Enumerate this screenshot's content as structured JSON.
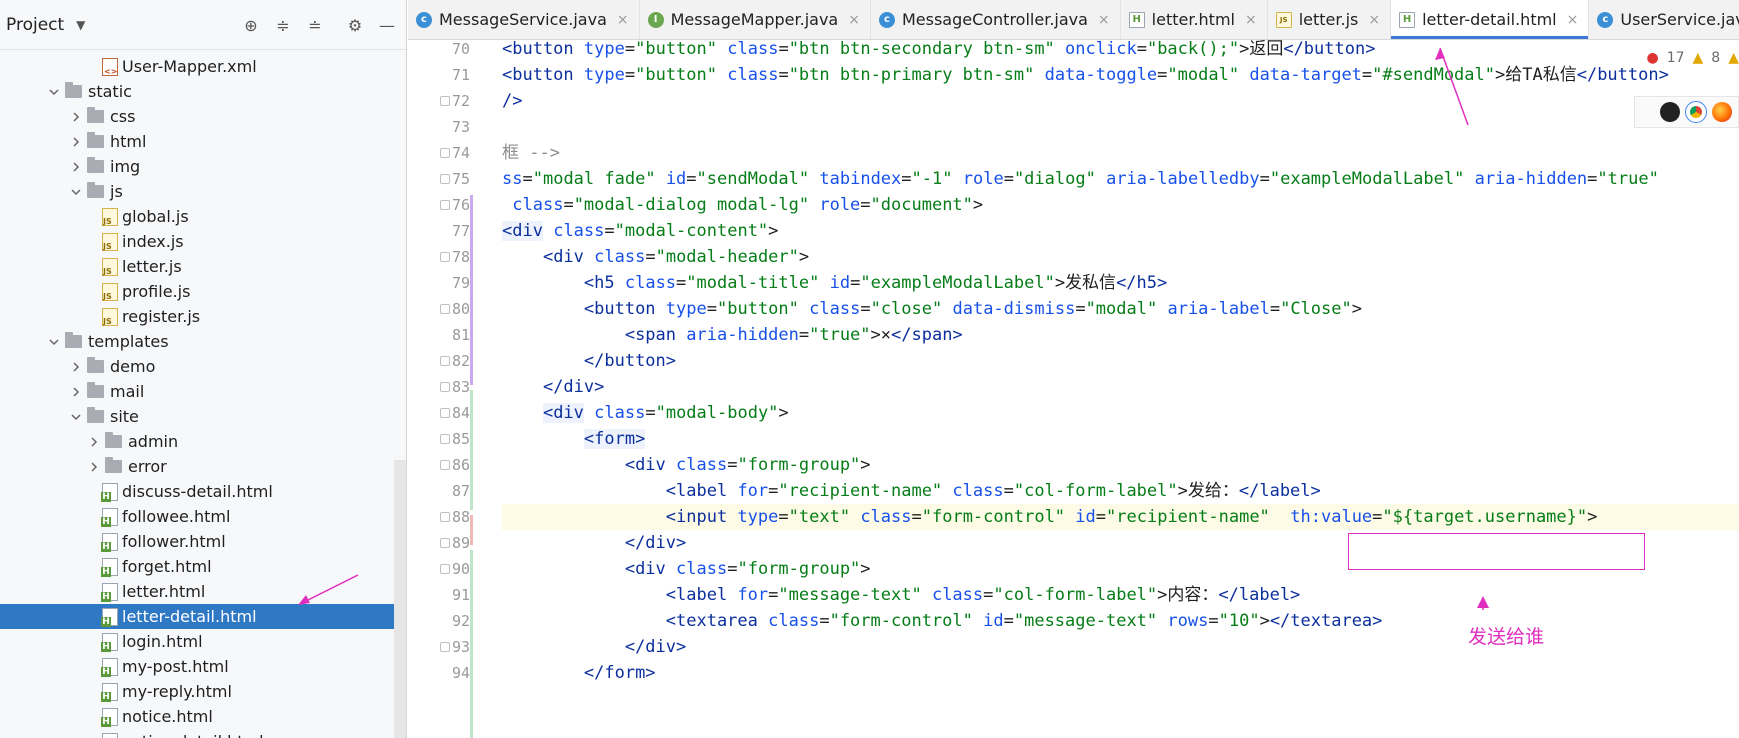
{
  "project": {
    "title": "Project",
    "tree": [
      {
        "label": "User-Mapper.xml",
        "type": "xml",
        "indent": 3,
        "arrow": ""
      },
      {
        "label": "static",
        "type": "folder",
        "indent": 1,
        "arrow": "down"
      },
      {
        "label": "css",
        "type": "folder",
        "indent": 2,
        "arrow": "right"
      },
      {
        "label": "html",
        "type": "folder",
        "indent": 2,
        "arrow": "right"
      },
      {
        "label": "img",
        "type": "folder",
        "indent": 2,
        "arrow": "right"
      },
      {
        "label": "js",
        "type": "folder",
        "indent": 2,
        "arrow": "down"
      },
      {
        "label": "global.js",
        "type": "js",
        "indent": 3,
        "arrow": ""
      },
      {
        "label": "index.js",
        "type": "js",
        "indent": 3,
        "arrow": ""
      },
      {
        "label": "letter.js",
        "type": "js",
        "indent": 3,
        "arrow": ""
      },
      {
        "label": "profile.js",
        "type": "js",
        "indent": 3,
        "arrow": ""
      },
      {
        "label": "register.js",
        "type": "js",
        "indent": 3,
        "arrow": ""
      },
      {
        "label": "templates",
        "type": "folder",
        "indent": 1,
        "arrow": "down"
      },
      {
        "label": "demo",
        "type": "folder",
        "indent": 2,
        "arrow": "right"
      },
      {
        "label": "mail",
        "type": "folder",
        "indent": 2,
        "arrow": "right"
      },
      {
        "label": "site",
        "type": "folder",
        "indent": 2,
        "arrow": "down"
      },
      {
        "label": "admin",
        "type": "folder",
        "indent": 3,
        "arrow": "right"
      },
      {
        "label": "error",
        "type": "folder",
        "indent": 3,
        "arrow": "right"
      },
      {
        "label": "discuss-detail.html",
        "type": "html",
        "indent": 3,
        "arrow": ""
      },
      {
        "label": "followee.html",
        "type": "html",
        "indent": 3,
        "arrow": ""
      },
      {
        "label": "follower.html",
        "type": "html",
        "indent": 3,
        "arrow": ""
      },
      {
        "label": "forget.html",
        "type": "html",
        "indent": 3,
        "arrow": ""
      },
      {
        "label": "letter.html",
        "type": "html",
        "indent": 3,
        "arrow": ""
      },
      {
        "label": "letter-detail.html",
        "type": "html",
        "indent": 3,
        "arrow": "",
        "selected": true
      },
      {
        "label": "login.html",
        "type": "html",
        "indent": 3,
        "arrow": ""
      },
      {
        "label": "my-post.html",
        "type": "html",
        "indent": 3,
        "arrow": ""
      },
      {
        "label": "my-reply.html",
        "type": "html",
        "indent": 3,
        "arrow": ""
      },
      {
        "label": "notice.html",
        "type": "html",
        "indent": 3,
        "arrow": ""
      },
      {
        "label": "notice-detail.html",
        "type": "html",
        "indent": 3,
        "arrow": ""
      }
    ]
  },
  "tabs": [
    {
      "label": "MessageService.java",
      "icon": "java-c"
    },
    {
      "label": "MessageMapper.java",
      "icon": "java-i"
    },
    {
      "label": "MessageController.java",
      "icon": "java-c"
    },
    {
      "label": "letter.html",
      "icon": "html"
    },
    {
      "label": "letter.js",
      "icon": "js"
    },
    {
      "label": "letter-detail.html",
      "icon": "html",
      "active": true
    },
    {
      "label": "UserService.java",
      "icon": "java-c"
    },
    {
      "label": "U",
      "icon": "java-c"
    }
  ],
  "inspections": {
    "errors": "17",
    "warnings": "8"
  },
  "code_lines": [
    {
      "n": "70",
      "html": "<span class='tag'>&lt;button</span> <span class='attr'>type</span>=<span class='str'>\"button\"</span> <span class='attr'>class</span>=<span class='str'>\"btn btn-secondary btn-sm\"</span> <span class='attr'>onclick</span>=<span class='str'>\"back();\"</span>&gt;返回<span class='tag'>&lt;/button&gt;</span>"
    },
    {
      "n": "71",
      "html": "<span class='tag'>&lt;button</span> <span class='attr'>type</span>=<span class='str'>\"button\"</span> <span class='attr'>class</span>=<span class='str'>\"btn btn-primary btn-sm\"</span> <span class='attr'>data-toggle</span>=<span class='str'>\"modal\"</span> <span class='attr'>data-target</span>=<span class='str'>\"#sendModal\"</span>&gt;给TA私信<span class='tag'>&lt;/button&gt;</span>"
    },
    {
      "n": "72",
      "html": "<span class='tag'>/&gt;</span>"
    },
    {
      "n": "73",
      "html": ""
    },
    {
      "n": "74",
      "html": "<span class='cmt'>框 --&gt;</span>"
    },
    {
      "n": "75",
      "html": "<span class='attr'>ss</span>=<span class='str'>\"modal fade\"</span> <span class='attr'>id</span>=<span class='str'>\"sendModal\"</span> <span class='attr'>tabindex</span>=<span class='str'>\"-1\"</span> <span class='attr'>role</span>=<span class='str'>\"dialog\"</span> <span class='attr'>aria-labelledby</span>=<span class='str'>\"exampleModalLabel\"</span> <span class='attr'>aria-hidden</span>=<span class='str'>\"true\"</span>"
    },
    {
      "n": "76",
      "html": " <span class='attr'>class</span>=<span class='str'>\"modal-dialog modal-lg\"</span> <span class='attr'>role</span>=<span class='str'>\"document\"</span>&gt;"
    },
    {
      "n": "77",
      "html": "<span class='tag tagbg'>&lt;div</span> <span class='attr'>class</span>=<span class='str'>\"modal-content\"</span>&gt;"
    },
    {
      "n": "78",
      "html": "    <span class='tag'>&lt;div</span> <span class='attr'>class</span>=<span class='str'>\"modal-header\"</span>&gt;"
    },
    {
      "n": "79",
      "html": "        <span class='tag'>&lt;h5</span> <span class='attr'>class</span>=<span class='str'>\"modal-title\"</span> <span class='attr'>id</span>=<span class='str'>\"exampleModalLabel\"</span>&gt;发私信<span class='tag'>&lt;/h5&gt;</span>"
    },
    {
      "n": "80",
      "html": "        <span class='tag'>&lt;button</span> <span class='attr'>type</span>=<span class='str'>\"button\"</span> <span class='attr'>class</span>=<span class='str'>\"close\"</span> <span class='attr'>data-dismiss</span>=<span class='str'>\"modal\"</span> <span class='attr'>aria-label</span>=<span class='str'>\"Close\"</span>&gt;"
    },
    {
      "n": "81",
      "html": "            <span class='tag'>&lt;span</span> <span class='attr'>aria-hidden</span>=<span class='str'>\"true\"</span>&gt;×<span class='tag'>&lt;/span&gt;</span>"
    },
    {
      "n": "82",
      "html": "        <span class='tag'>&lt;/button&gt;</span>"
    },
    {
      "n": "83",
      "html": "    <span class='tag'>&lt;/div&gt;</span>"
    },
    {
      "n": "84",
      "html": "    <span class='tag tagbg'>&lt;div</span> <span class='attr'>class</span>=<span class='str'>\"modal-body\"</span>&gt;"
    },
    {
      "n": "85",
      "html": "        <span class='tag tagbg'>&lt;form&gt;</span>"
    },
    {
      "n": "86",
      "html": "            <span class='tag'>&lt;div</span> <span class='attr'>class</span>=<span class='str'>\"form-group\"</span>&gt;"
    },
    {
      "n": "87",
      "html": "                <span class='tag'>&lt;label</span> <span class='attr'>for</span>=<span class='str'>\"recipient-name\"</span> <span class='attr'>class</span>=<span class='str'>\"col-form-label\"</span>&gt;发给：<span class='tag'>&lt;/label&gt;</span>"
    },
    {
      "n": "88",
      "html": "                <span class='tag'>&lt;input</span> <span class='attr'>type</span>=<span class='str'>\"text\"</span> <span class='attr'>class</span>=<span class='str'>\"form-control\"</span> <span class='attr'>id</span>=<span class='str'>\"recipient-name\"</span>  <span class='attr'>th:value</span>=<span class='str'>\"${target.username}\"</span>&gt;",
      "highlight": true
    },
    {
      "n": "89",
      "html": "            <span class='tag'>&lt;/div&gt;</span>"
    },
    {
      "n": "90",
      "html": "            <span class='tag'>&lt;div</span> <span class='attr'>class</span>=<span class='str'>\"form-group\"</span>&gt;"
    },
    {
      "n": "91",
      "html": "                <span class='tag'>&lt;label</span> <span class='attr'>for</span>=<span class='str'>\"message-text\"</span> <span class='attr'>class</span>=<span class='str'>\"col-form-label\"</span>&gt;内容：<span class='tag'>&lt;/label&gt;</span>"
    },
    {
      "n": "92",
      "html": "                <span class='tag'>&lt;textarea</span> <span class='attr'>class</span>=<span class='str'>\"form-control\"</span> <span class='attr'>id</span>=<span class='str'>\"message-text\"</span> <span class='attr'>rows</span>=<span class='str'>\"10\"</span>&gt;<span class='tag'>&lt;/textarea&gt;</span>"
    },
    {
      "n": "93",
      "html": "            <span class='tag'>&lt;/div&gt;</span>"
    },
    {
      "n": "94",
      "html": "        <span class='tag'>&lt;/form&gt;</span>"
    }
  ],
  "annotation": {
    "label": "发送给谁",
    "color": "#e02fbf"
  }
}
